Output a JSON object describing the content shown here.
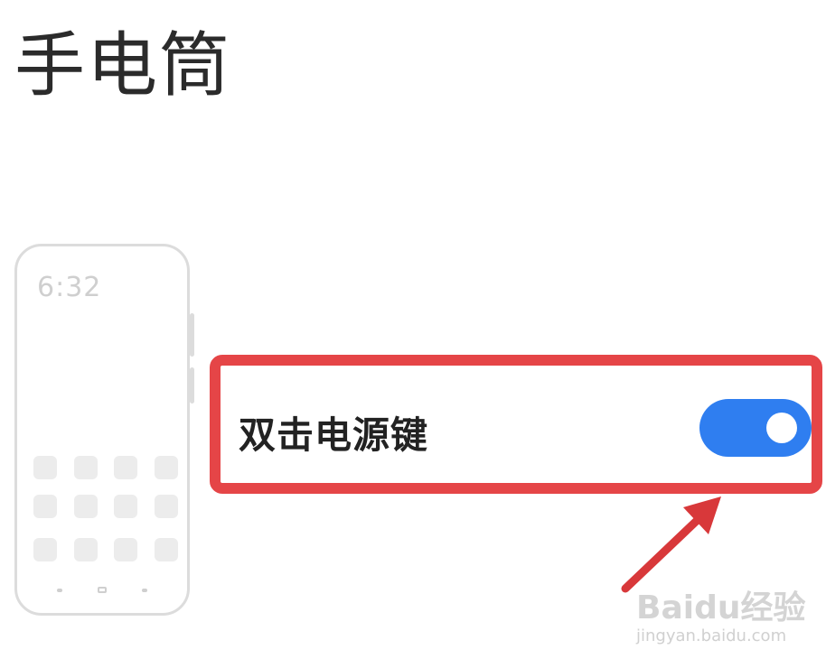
{
  "header": {
    "title": "手电筒"
  },
  "phone_illustration": {
    "time": "6:32"
  },
  "setting": {
    "label": "双击电源键",
    "toggle_on": true,
    "toggle_color": "#2f7ef0"
  },
  "annotation": {
    "highlight_color": "#e54547",
    "arrow_color": "#d8383a"
  },
  "watermark": {
    "main": "Baidu经验",
    "sub": "jingyan.baidu.com"
  }
}
